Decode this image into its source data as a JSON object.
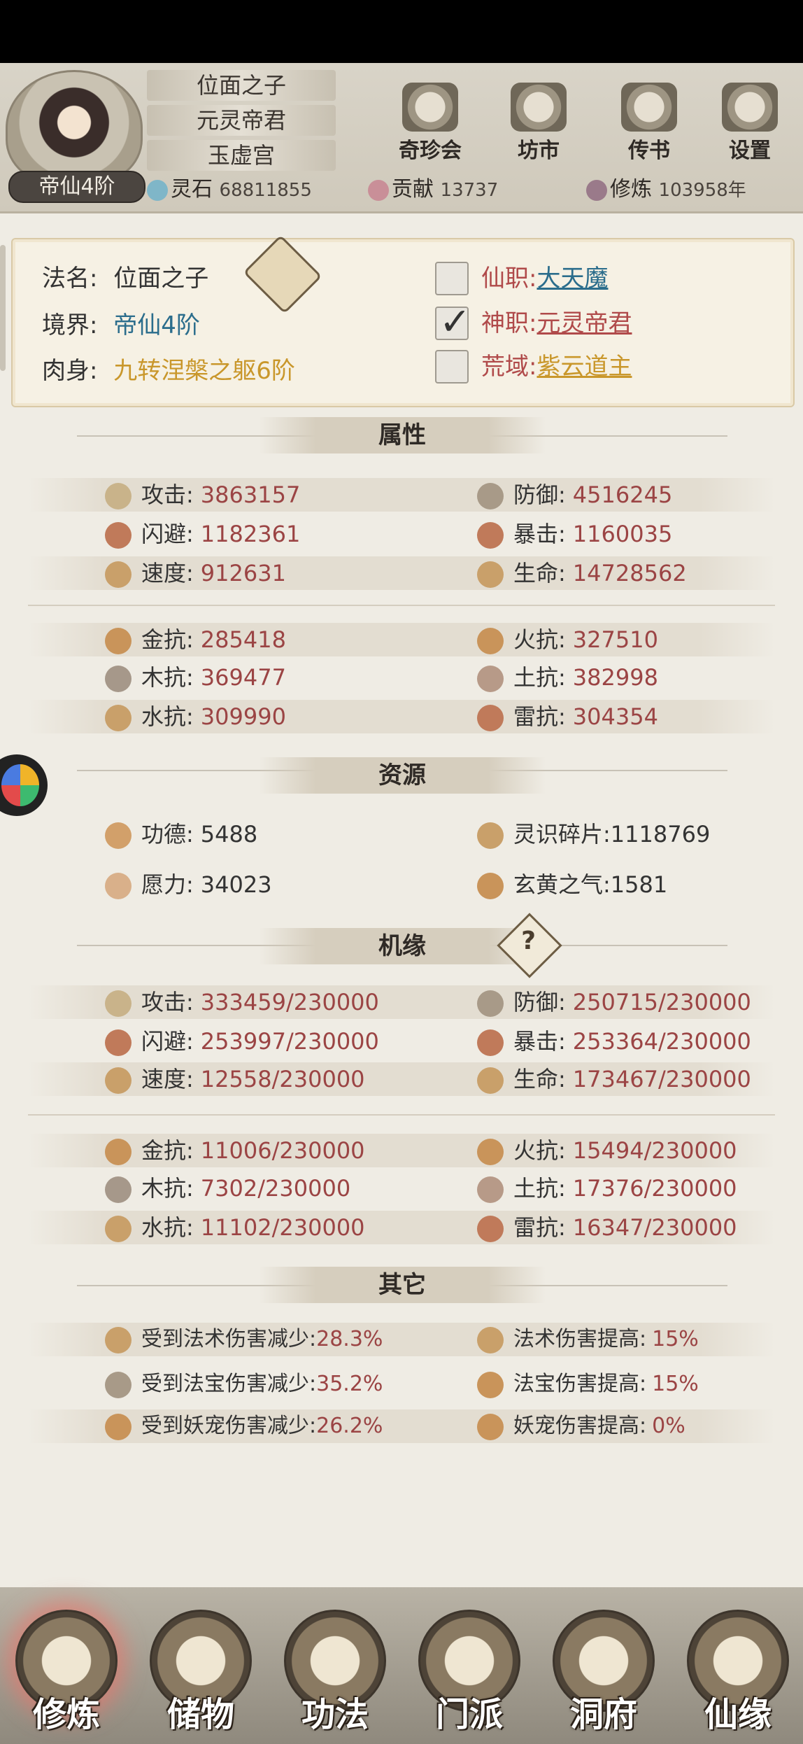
{
  "header": {
    "names": [
      "位面之子",
      "元灵帝君",
      "玉虚宫"
    ],
    "rank": "帝仙4阶",
    "menu": [
      {
        "label": "奇珍会",
        "icon": "treasure-pavilion-icon"
      },
      {
        "label": "坊市",
        "icon": "market-icon"
      },
      {
        "label": "传书",
        "icon": "scroll-letter-icon"
      },
      {
        "label": "设置",
        "icon": "gear-icon"
      }
    ],
    "resources": [
      {
        "label": "灵石",
        "value": "68811855",
        "icon": "spirit-stone-icon"
      },
      {
        "label": "贡献",
        "value": "13737",
        "icon": "contribution-icon"
      },
      {
        "label": "修炼",
        "value": "103958年",
        "icon": "cultivation-icon"
      }
    ]
  },
  "info": {
    "name_label": "法名:",
    "name_value": "位面之子",
    "realm_label": "境界:",
    "realm_value": "帝仙4阶",
    "body_label": "肉身:",
    "body_value": "九转涅槃之躯6阶",
    "roles": [
      {
        "label": "仙职:",
        "value": "大天魔",
        "checked": false
      },
      {
        "label": "神职:",
        "value": "元灵帝君",
        "checked": true
      },
      {
        "label": "荒域:",
        "value": "紫云道主",
        "checked": false
      }
    ]
  },
  "sections": {
    "attributes": "属性",
    "resources": "资源",
    "fortune": "机缘",
    "other": "其它"
  },
  "attributes": [
    {
      "label": "攻击:",
      "value": "3863157"
    },
    {
      "label": "防御:",
      "value": "4516245"
    },
    {
      "label": "闪避:",
      "value": "1182361"
    },
    {
      "label": "暴击:",
      "value": "1160035"
    },
    {
      "label": "速度:",
      "value": "912631"
    },
    {
      "label": "生命:",
      "value": "14728562"
    }
  ],
  "resistances": [
    {
      "label": "金抗:",
      "value": "285418"
    },
    {
      "label": "火抗:",
      "value": "327510"
    },
    {
      "label": "木抗:",
      "value": "369477"
    },
    {
      "label": "土抗:",
      "value": "382998"
    },
    {
      "label": "水抗:",
      "value": "309990"
    },
    {
      "label": "雷抗:",
      "value": "304354"
    }
  ],
  "resources": [
    {
      "label": "功德:",
      "value": "5488"
    },
    {
      "label": "灵识碎片:",
      "value": "1118769"
    },
    {
      "label": "愿力:",
      "value": "34023"
    },
    {
      "label": "玄黄之气:",
      "value": "1581"
    }
  ],
  "fortune_attributes": [
    {
      "label": "攻击:",
      "value": "333459/230000"
    },
    {
      "label": "防御:",
      "value": "250715/230000"
    },
    {
      "label": "闪避:",
      "value": "253997/230000"
    },
    {
      "label": "暴击:",
      "value": "253364/230000"
    },
    {
      "label": "速度:",
      "value": "12558/230000"
    },
    {
      "label": "生命:",
      "value": "173467/230000"
    }
  ],
  "fortune_resistances": [
    {
      "label": "金抗:",
      "value": "11006/230000"
    },
    {
      "label": "火抗:",
      "value": "15494/230000"
    },
    {
      "label": "木抗:",
      "value": "7302/230000"
    },
    {
      "label": "土抗:",
      "value": "17376/230000"
    },
    {
      "label": "水抗:",
      "value": "11102/230000"
    },
    {
      "label": "雷抗:",
      "value": "16347/230000"
    }
  ],
  "other": [
    {
      "label": "受到法术伤害减少:",
      "value": "28.3%"
    },
    {
      "label": "法术伤害提高:",
      "value": "15%"
    },
    {
      "label": "受到法宝伤害减少:",
      "value": "35.2%"
    },
    {
      "label": "法宝伤害提高:",
      "value": "15%"
    },
    {
      "label": "受到妖宠伤害减少:",
      "value": "26.2%"
    },
    {
      "label": "妖宠伤害提高:",
      "value": "0%"
    }
  ],
  "bottom_nav": [
    "修炼",
    "储物",
    "功法",
    "门派",
    "洞府",
    "仙缘"
  ]
}
